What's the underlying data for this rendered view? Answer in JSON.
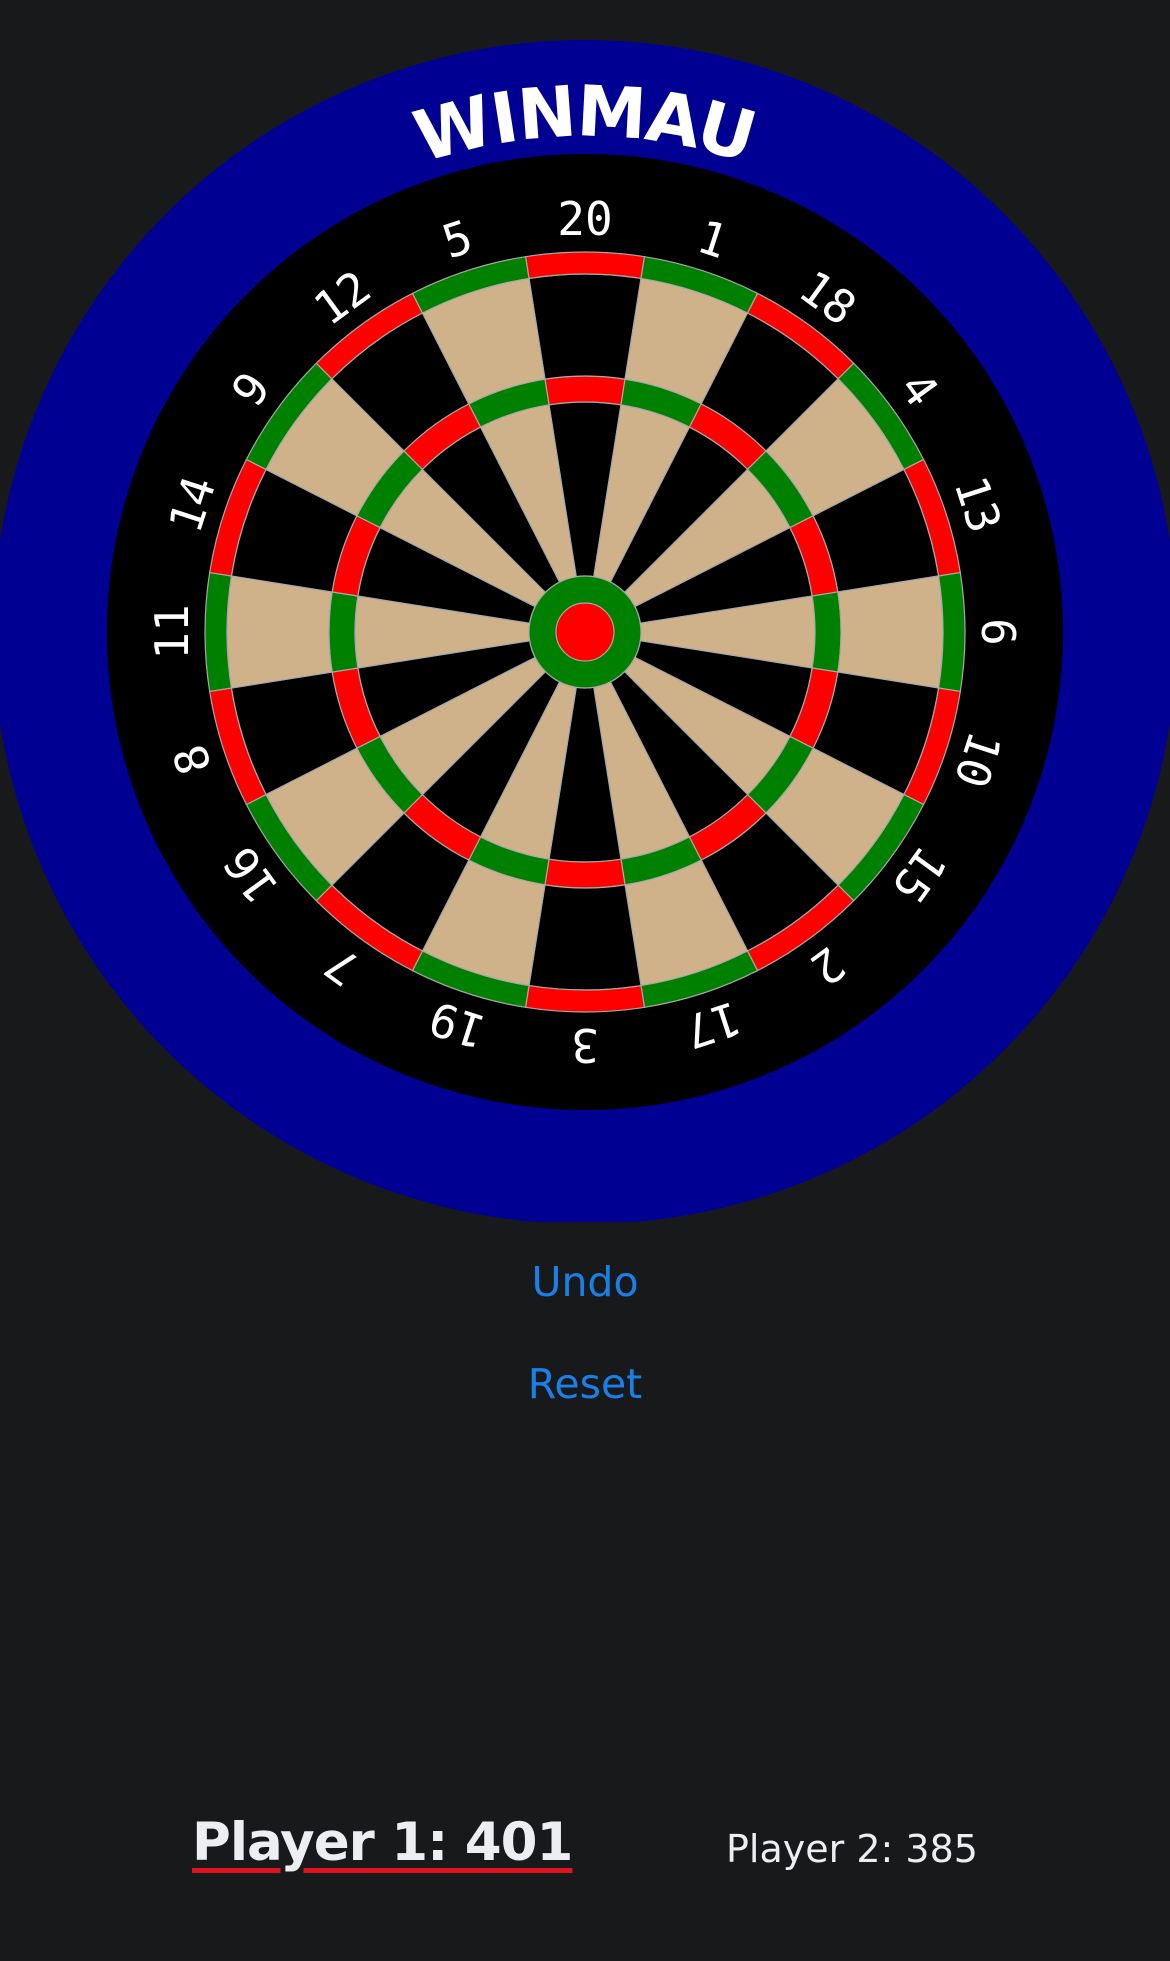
{
  "board": {
    "brand": "WINMAU",
    "numbers": [
      "20",
      "1",
      "18",
      "4",
      "13",
      "6",
      "10",
      "15",
      "2",
      "17",
      "3",
      "19",
      "7",
      "16",
      "8",
      "11",
      "14",
      "9",
      "12",
      "5"
    ],
    "colors": {
      "surround": "#000092",
      "board_bg": "#000000",
      "light_segment": "#d0b28a",
      "dark_segment": "#000000",
      "red": "#ff0000",
      "green": "#008000",
      "wire": "#a8a8a8",
      "numbers": "#ffffff"
    }
  },
  "actions": {
    "undo_label": "Undo",
    "reset_label": "Reset",
    "color": "#1a7fe6"
  },
  "players": [
    {
      "label": "Player 1: 401",
      "active": true
    },
    {
      "label": "Player 2: 385",
      "active": false
    }
  ]
}
